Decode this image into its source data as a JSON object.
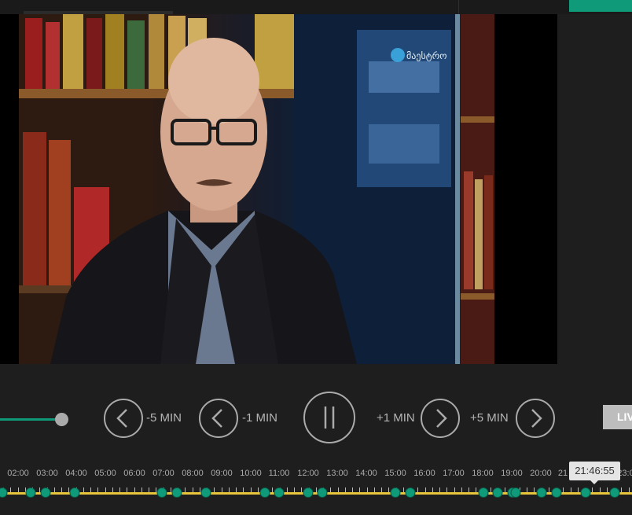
{
  "video": {
    "channel_logo_text": "მაესტრო"
  },
  "controls": {
    "back5_label": "-5 MIN",
    "back1_label": "-1 MIN",
    "fwd1_label": "+1 MIN",
    "fwd5_label": "+5 MIN",
    "live_label": "LIV",
    "volume_level": 1.0,
    "playing": true
  },
  "timeline": {
    "hour_labels": [
      "02:00",
      "03:00",
      "04:00",
      "05:00",
      "06:00",
      "07:00",
      "08:00",
      "09:00",
      "10:00",
      "11:00",
      "12:00",
      "13:00",
      "14:00",
      "15:00",
      "16:00",
      "17:00",
      "18:00",
      "19:00",
      "20:00",
      "21",
      "23:0"
    ],
    "current_time_tooltip": "21:46:55"
  },
  "colors": {
    "accent": "#0f9b7a",
    "timeline_track": "#e8c53a",
    "background": "#1e1e1e"
  }
}
